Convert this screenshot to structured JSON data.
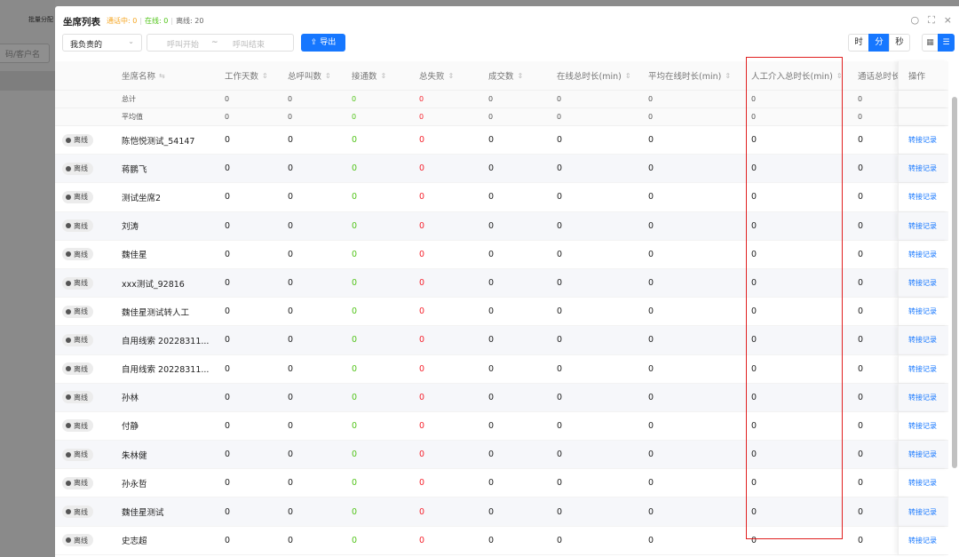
{
  "background": {
    "batch_label": "批量分配",
    "search_placeholder": "码/客户名"
  },
  "header": {
    "title": "坐席列表",
    "stats": {
      "calling_label": "通话中: 0",
      "online_label": "在线: 0",
      "offline_label": "离线: 20"
    },
    "refresh_icon": "refresh-icon",
    "fullscreen_icon": "fullscreen-icon",
    "close_icon": "close-icon"
  },
  "toolbar": {
    "scope_select": "我负责的",
    "range_start_placeholder": "呼叫开始",
    "range_sep": "~",
    "range_end_placeholder": "呼叫结束",
    "export_label": "导出",
    "time_units": [
      "时",
      "分",
      "秒"
    ],
    "active_time_unit": "分"
  },
  "table": {
    "columns": [
      "坐席名称",
      "工作天数",
      "总呼叫数",
      "接通数",
      "总失败",
      "成交数",
      "在线总时长(min)",
      "平均在线时长(min)",
      "人工介入总时长(min)",
      "通话总时长",
      "操作"
    ],
    "summary_rows": [
      {
        "label": "总计",
        "values": [
          "0",
          "0",
          "0",
          "0",
          "0",
          "0",
          "0",
          "0",
          "0"
        ]
      },
      {
        "label": "平均值",
        "values": [
          "0",
          "0",
          "0",
          "0",
          "0",
          "0",
          "0",
          "0",
          "0"
        ]
      }
    ],
    "status_label": "离线",
    "action_label": "转接记录",
    "rows": [
      {
        "name": "陈恺悦测试_54147",
        "values": [
          "0",
          "0",
          "0",
          "0",
          "0",
          "0",
          "0",
          "0",
          "0"
        ]
      },
      {
        "name": "蒋鹏飞",
        "values": [
          "0",
          "0",
          "0",
          "0",
          "0",
          "0",
          "0",
          "0",
          "0"
        ]
      },
      {
        "name": "测试坐席2",
        "values": [
          "0",
          "0",
          "0",
          "0",
          "0",
          "0",
          "0",
          "0",
          "0"
        ]
      },
      {
        "name": "刘涛",
        "values": [
          "0",
          "0",
          "0",
          "0",
          "0",
          "0",
          "0",
          "0",
          "0"
        ]
      },
      {
        "name": "魏佳星",
        "values": [
          "0",
          "0",
          "0",
          "0",
          "0",
          "0",
          "0",
          "0",
          "0"
        ]
      },
      {
        "name": "xxx测试_92816",
        "values": [
          "0",
          "0",
          "0",
          "0",
          "0",
          "0",
          "0",
          "0",
          "0"
        ]
      },
      {
        "name": "魏佳星测试转人工",
        "values": [
          "0",
          "0",
          "0",
          "0",
          "0",
          "0",
          "0",
          "0",
          "0"
        ]
      },
      {
        "name": "自用线索 20228311...",
        "values": [
          "0",
          "0",
          "0",
          "0",
          "0",
          "0",
          "0",
          "0",
          "0"
        ]
      },
      {
        "name": "自用线索 20228311...",
        "values": [
          "0",
          "0",
          "0",
          "0",
          "0",
          "0",
          "0",
          "0",
          "0"
        ]
      },
      {
        "name": "孙林",
        "values": [
          "0",
          "0",
          "0",
          "0",
          "0",
          "0",
          "0",
          "0",
          "0"
        ]
      },
      {
        "name": "付静",
        "values": [
          "0",
          "0",
          "0",
          "0",
          "0",
          "0",
          "0",
          "0",
          "0"
        ]
      },
      {
        "name": "朱林健",
        "values": [
          "0",
          "0",
          "0",
          "0",
          "0",
          "0",
          "0",
          "0",
          "0"
        ]
      },
      {
        "name": "孙永哲",
        "values": [
          "0",
          "0",
          "0",
          "0",
          "0",
          "0",
          "0",
          "0",
          "0"
        ]
      },
      {
        "name": "魏佳星测试",
        "values": [
          "0",
          "0",
          "0",
          "0",
          "0",
          "0",
          "0",
          "0",
          "0"
        ]
      },
      {
        "name": "史志超",
        "values": [
          "0",
          "0",
          "0",
          "0",
          "0",
          "0",
          "0",
          "0",
          "0"
        ]
      }
    ]
  },
  "colors": {
    "accent": "#1677ff",
    "success": "#52c41a",
    "danger": "#f5222d",
    "warning": "#f5a623",
    "highlight_border": "#e02020"
  }
}
